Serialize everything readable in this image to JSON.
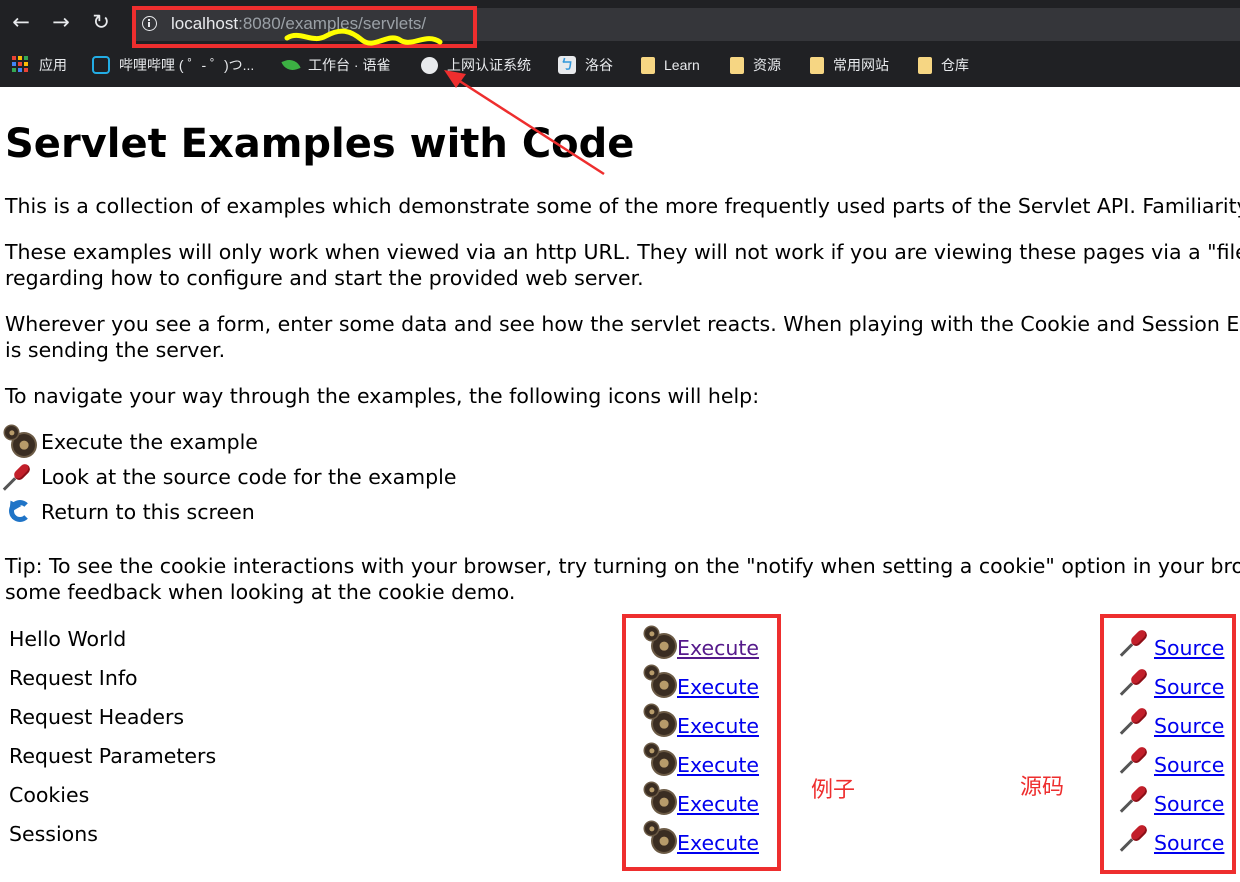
{
  "browser": {
    "url_host": "localhost",
    "url_rest": ":8080/examples/servlets/",
    "nav_icons": [
      "back-arrow-icon",
      "forward-arrow-icon",
      "reload-icon",
      "info-icon"
    ],
    "bookmarks": [
      {
        "label": "应用",
        "icon": "apps-grid-icon"
      },
      {
        "label": "哔哩哔哩 ( ゜- ゜)つ...",
        "icon": "bilibili-icon"
      },
      {
        "label": "工作台 · 语雀",
        "icon": "yuque-leaf-icon"
      },
      {
        "label": "上网认证系统",
        "icon": "globe-icon"
      },
      {
        "label": "洛谷",
        "icon": "luogu-icon"
      },
      {
        "label": "Learn",
        "icon": "folder-icon"
      },
      {
        "label": "资源",
        "icon": "folder-icon"
      },
      {
        "label": "常用网站",
        "icon": "folder-icon"
      },
      {
        "label": "仓库",
        "icon": "folder-icon"
      }
    ],
    "colors": {
      "chrome": "#202124",
      "address_bar": "#35363a"
    }
  },
  "page": {
    "title": "Servlet Examples with Code",
    "paragraphs": [
      "This is a collection of examples which demonstrate some of the more frequently used parts of the Servlet API. Familiarity with the ...",
      "These examples will only work when viewed via an http URL. They will not work if you are viewing these pages via a \"file://...\" URL.",
      "regarding how to configure and start the provided web server.",
      "Wherever you see a form, enter some data and see how the servlet reacts. When playing with the Cookie and Session Examples, ju",
      "is sending the server.",
      "To navigate your way through the examples, the following icons will help:"
    ],
    "legend": [
      {
        "icon": "execute-gears-icon",
        "label": "Execute the example"
      },
      {
        "icon": "source-screwdriver-icon",
        "label": "Look at the source code for the example"
      },
      {
        "icon": "return-arrow-icon",
        "label": "Return to this screen"
      }
    ],
    "tip": [
      "Tip: To see the cookie interactions with your browser, try turning on the \"notify when setting a cookie\" option in your browser pref",
      "some feedback when looking at the cookie demo."
    ],
    "examples": [
      {
        "name": "Hello World",
        "execute": "Execute",
        "source": "Source",
        "execute_visited": true
      },
      {
        "name": "Request Info",
        "execute": "Execute",
        "source": "Source",
        "execute_visited": false
      },
      {
        "name": "Request Headers",
        "execute": "Execute",
        "source": "Source",
        "execute_visited": false
      },
      {
        "name": "Request Parameters",
        "execute": "Execute",
        "source": "Source",
        "execute_visited": false
      },
      {
        "name": "Cookies",
        "execute": "Execute",
        "source": "Source",
        "execute_visited": false
      },
      {
        "name": "Sessions",
        "execute": "Execute",
        "source": "Source",
        "execute_visited": false
      }
    ]
  },
  "annotations": {
    "execute_label": "例子",
    "source_label": "源码",
    "color": "#ee2e2e",
    "highlight_color": "#ffff00"
  }
}
